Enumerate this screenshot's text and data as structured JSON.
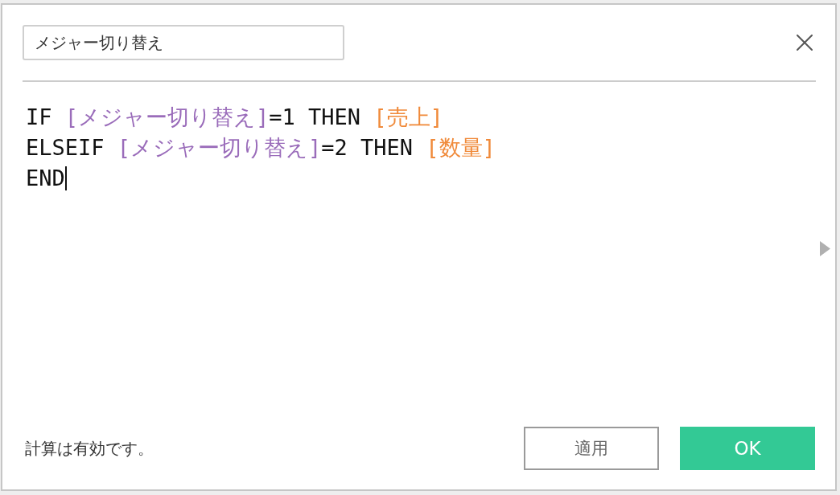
{
  "dialog": {
    "name_field": {
      "value": "メジャー切り替え"
    },
    "formula": {
      "lines": [
        {
          "caret": false,
          "tokens": [
            {
              "kind": "plain",
              "text": "IF "
            },
            {
              "kind": "parameter",
              "text": "[メジャー切り替え]"
            },
            {
              "kind": "plain",
              "text": "=1 THEN "
            },
            {
              "kind": "field",
              "text": "[売上]"
            }
          ]
        },
        {
          "caret": false,
          "tokens": [
            {
              "kind": "plain",
              "text": "ELSEIF "
            },
            {
              "kind": "parameter",
              "text": "[メジャー切り替え]"
            },
            {
              "kind": "plain",
              "text": "=2 THEN "
            },
            {
              "kind": "field",
              "text": "[数量]"
            }
          ]
        },
        {
          "caret": true,
          "tokens": [
            {
              "kind": "plain",
              "text": "END"
            }
          ]
        }
      ]
    },
    "side_panel": {
      "expanded": false
    },
    "status_message": "計算は有効です。",
    "buttons": [
      {
        "kind": "secondary",
        "label": "適用"
      },
      {
        "kind": "primary",
        "label": "OK"
      }
    ]
  }
}
